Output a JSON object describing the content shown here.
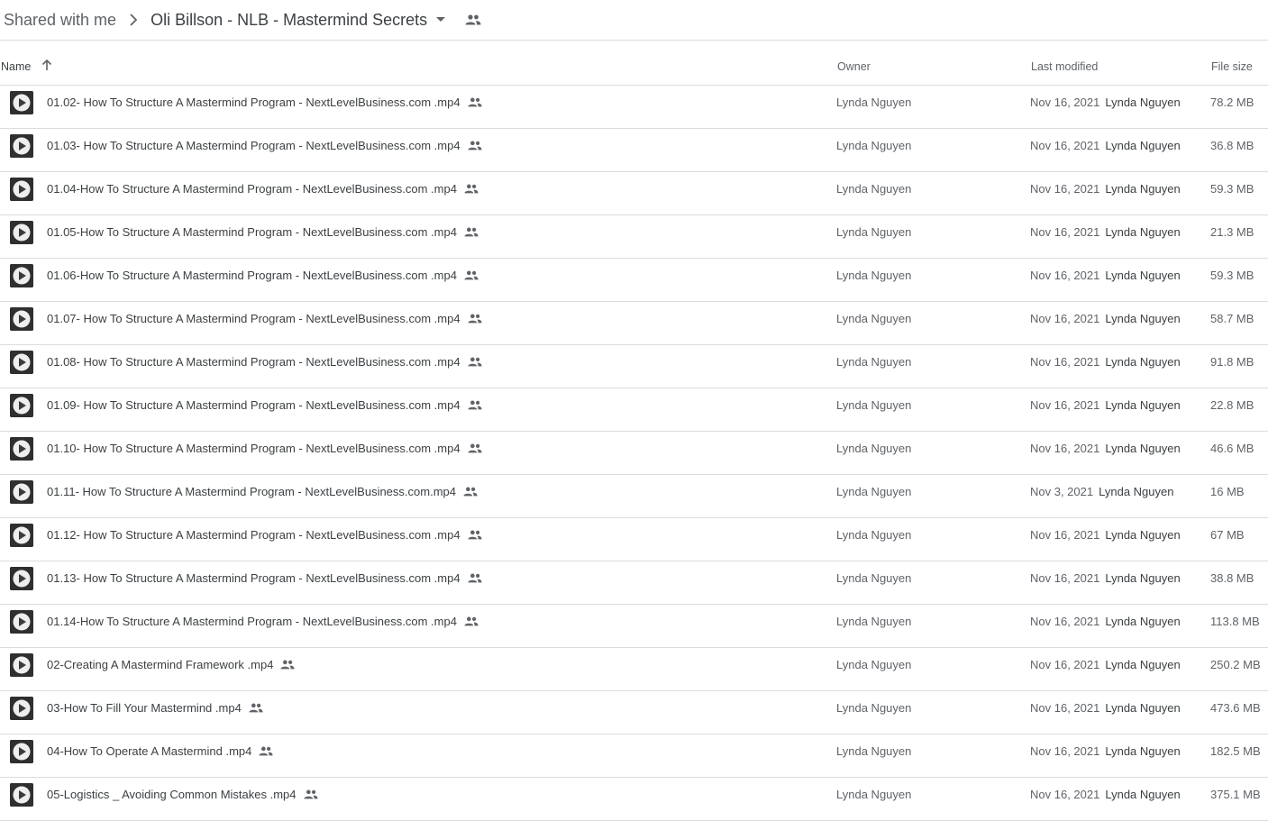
{
  "breadcrumb": {
    "root": "Shared with me",
    "current": "Oli Billson - NLB - Mastermind Secrets"
  },
  "columns": {
    "name": "Name",
    "owner": "Owner",
    "modified": "Last modified",
    "size": "File size"
  },
  "icons": {
    "breadcrumb_separator": "chevron-right-icon",
    "folder_menu": "caret-down-icon",
    "shared": "people-icon",
    "sort": "arrow-up-icon",
    "file": "video-thumbnail-icon"
  },
  "files": [
    {
      "name": "01.02- How To Structure A Mastermind Program - NextLevelBusiness.com .mp4",
      "owner": "Lynda Nguyen",
      "modified_date": "Nov 16, 2021",
      "modified_by": "Lynda Nguyen",
      "size": "78.2 MB"
    },
    {
      "name": "01.03- How To Structure A Mastermind Program - NextLevelBusiness.com .mp4",
      "owner": "Lynda Nguyen",
      "modified_date": "Nov 16, 2021",
      "modified_by": "Lynda Nguyen",
      "size": "36.8 MB"
    },
    {
      "name": "01.04-How To Structure A Mastermind Program - NextLevelBusiness.com .mp4",
      "owner": "Lynda Nguyen",
      "modified_date": "Nov 16, 2021",
      "modified_by": "Lynda Nguyen",
      "size": "59.3 MB"
    },
    {
      "name": "01.05-How To Structure A Mastermind Program - NextLevelBusiness.com .mp4",
      "owner": "Lynda Nguyen",
      "modified_date": "Nov 16, 2021",
      "modified_by": "Lynda Nguyen",
      "size": "21.3 MB"
    },
    {
      "name": "01.06-How To Structure A Mastermind Program - NextLevelBusiness.com .mp4",
      "owner": "Lynda Nguyen",
      "modified_date": "Nov 16, 2021",
      "modified_by": "Lynda Nguyen",
      "size": "59.3 MB"
    },
    {
      "name": "01.07- How To Structure A Mastermind Program - NextLevelBusiness.com .mp4",
      "owner": "Lynda Nguyen",
      "modified_date": "Nov 16, 2021",
      "modified_by": "Lynda Nguyen",
      "size": "58.7 MB"
    },
    {
      "name": "01.08- How To Structure A Mastermind Program - NextLevelBusiness.com .mp4",
      "owner": "Lynda Nguyen",
      "modified_date": "Nov 16, 2021",
      "modified_by": "Lynda Nguyen",
      "size": "91.8 MB"
    },
    {
      "name": "01.09- How To Structure A Mastermind Program - NextLevelBusiness.com .mp4",
      "owner": "Lynda Nguyen",
      "modified_date": "Nov 16, 2021",
      "modified_by": "Lynda Nguyen",
      "size": "22.8 MB"
    },
    {
      "name": "01.10- How To Structure A Mastermind Program - NextLevelBusiness.com .mp4",
      "owner": "Lynda Nguyen",
      "modified_date": "Nov 16, 2021",
      "modified_by": "Lynda Nguyen",
      "size": "46.6 MB"
    },
    {
      "name": "01.11- How To Structure A Mastermind Program - NextLevelBusiness.com.mp4",
      "owner": "Lynda Nguyen",
      "modified_date": "Nov 3, 2021",
      "modified_by": "Lynda Nguyen",
      "size": "16 MB"
    },
    {
      "name": "01.12- How To Structure A Mastermind Program - NextLevelBusiness.com .mp4",
      "owner": "Lynda Nguyen",
      "modified_date": "Nov 16, 2021",
      "modified_by": "Lynda Nguyen",
      "size": "67 MB"
    },
    {
      "name": "01.13- How To Structure A Mastermind Program - NextLevelBusiness.com .mp4",
      "owner": "Lynda Nguyen",
      "modified_date": "Nov 16, 2021",
      "modified_by": "Lynda Nguyen",
      "size": "38.8 MB"
    },
    {
      "name": "01.14-How To Structure A Mastermind Program - NextLevelBusiness.com .mp4",
      "owner": "Lynda Nguyen",
      "modified_date": "Nov 16, 2021",
      "modified_by": "Lynda Nguyen",
      "size": "113.8 MB"
    },
    {
      "name": "02-Creating A Mastermind Framework .mp4",
      "owner": "Lynda Nguyen",
      "modified_date": "Nov 16, 2021",
      "modified_by": "Lynda Nguyen",
      "size": "250.2 MB"
    },
    {
      "name": "03-How To Fill Your Mastermind .mp4",
      "owner": "Lynda Nguyen",
      "modified_date": "Nov 16, 2021",
      "modified_by": "Lynda Nguyen",
      "size": "473.6 MB"
    },
    {
      "name": "04-How To Operate A Mastermind .mp4",
      "owner": "Lynda Nguyen",
      "modified_date": "Nov 16, 2021",
      "modified_by": "Lynda Nguyen",
      "size": "182.5 MB"
    },
    {
      "name": "05-Logistics _ Avoiding Common Mistakes .mp4",
      "owner": "Lynda Nguyen",
      "modified_date": "Nov 16, 2021",
      "modified_by": "Lynda Nguyen",
      "size": "375.1 MB"
    }
  ]
}
